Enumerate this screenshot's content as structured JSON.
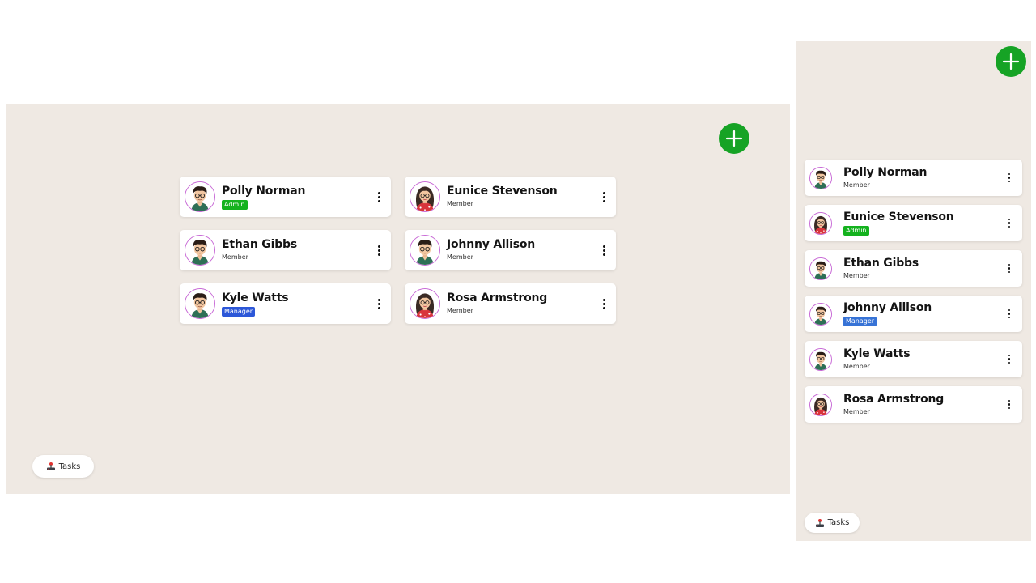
{
  "desktop": {
    "add_button_icon": "plus-icon",
    "tasks_label": "Tasks",
    "tasks_icon": "joystick-icon",
    "members": [
      {
        "name": "Polly Norman",
        "role": "Admin",
        "role_style": "badge-admin",
        "avatar": "male-avatar"
      },
      {
        "name": "Eunice Stevenson",
        "role": "Member",
        "role_style": "plain",
        "avatar": "female-avatar"
      },
      {
        "name": "Ethan Gibbs",
        "role": "Member",
        "role_style": "plain",
        "avatar": "male-avatar"
      },
      {
        "name": "Johnny Allison",
        "role": "Member",
        "role_style": "plain",
        "avatar": "male-avatar"
      },
      {
        "name": "Kyle Watts",
        "role": "Manager",
        "role_style": "badge-manager",
        "avatar": "male-avatar"
      },
      {
        "name": "Rosa Armstrong",
        "role": "Member",
        "role_style": "plain",
        "avatar": "female-avatar"
      }
    ]
  },
  "mobile": {
    "add_button_icon": "plus-icon",
    "tasks_label": "Tasks",
    "tasks_icon": "joystick-icon",
    "members": [
      {
        "name": "Polly Norman",
        "role": "Member",
        "role_style": "plain",
        "avatar": "male-avatar"
      },
      {
        "name": "Eunice Stevenson",
        "role": "Admin",
        "role_style": "badge-admin",
        "avatar": "female-avatar"
      },
      {
        "name": "Ethan Gibbs",
        "role": "Member",
        "role_style": "plain",
        "avatar": "male-avatar"
      },
      {
        "name": "Johnny Allison",
        "role": "Manager",
        "role_style": "badge-manager",
        "avatar": "male-avatar"
      },
      {
        "name": "Kyle Watts",
        "role": "Member",
        "role_style": "plain",
        "avatar": "male-avatar"
      },
      {
        "name": "Rosa Armstrong",
        "role": "Member",
        "role_style": "plain",
        "avatar": "female-avatar"
      }
    ]
  },
  "colors": {
    "background_panel": "#efe9e3",
    "fab": "#16a325",
    "admin_badge": "#14b21e",
    "manager_badge": "#2c57d8",
    "avatar_ring": "#c86ad6"
  }
}
